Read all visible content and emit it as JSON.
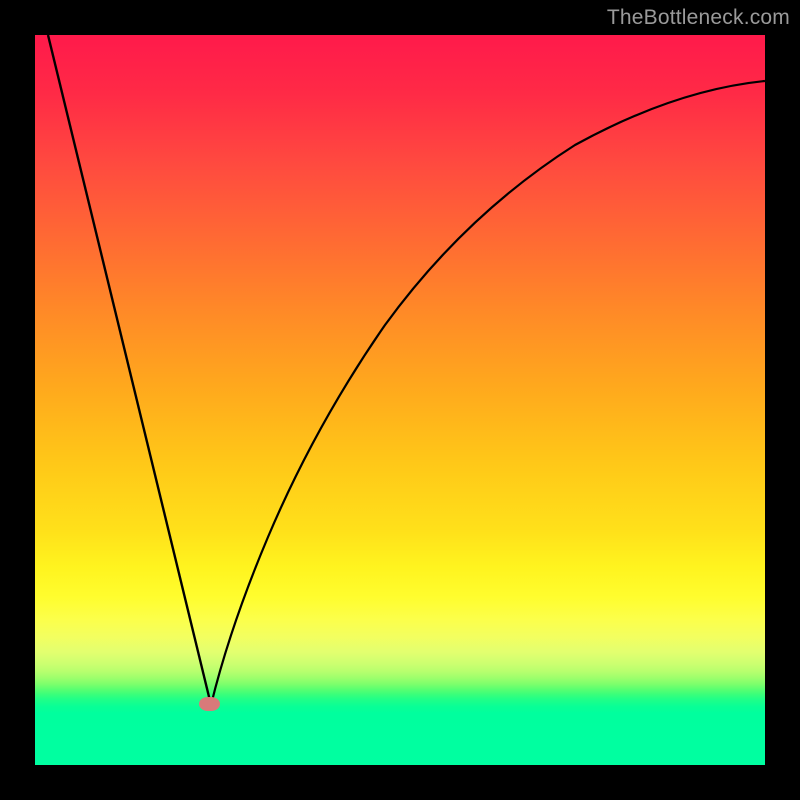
{
  "watermark": "TheBottleneck.com",
  "chart_data": {
    "type": "line",
    "title": "",
    "xlabel": "",
    "ylabel": "",
    "xlim": [
      0,
      100
    ],
    "ylim": [
      0,
      100
    ],
    "grid": false,
    "legend": false,
    "series": [
      {
        "name": "bottleneck-curve",
        "x": [
          0,
          5,
          10,
          15,
          20,
          23.7,
          25,
          30,
          35,
          40,
          45,
          50,
          55,
          60,
          65,
          70,
          75,
          80,
          85,
          90,
          95,
          100
        ],
        "y": [
          100,
          79,
          58,
          37,
          16,
          0,
          5,
          23,
          37,
          48,
          57,
          64,
          70,
          75,
          79,
          82.5,
          85.5,
          88,
          90,
          91.5,
          92.7,
          93.7
        ]
      }
    ],
    "annotations": [
      {
        "name": "optimum-marker",
        "x": 23.7,
        "y": 0
      }
    ],
    "background_gradient": {
      "top_color": "#ff1a4b",
      "mid_color": "#ffe11a",
      "bottom_color": "#00ffa1"
    }
  }
}
